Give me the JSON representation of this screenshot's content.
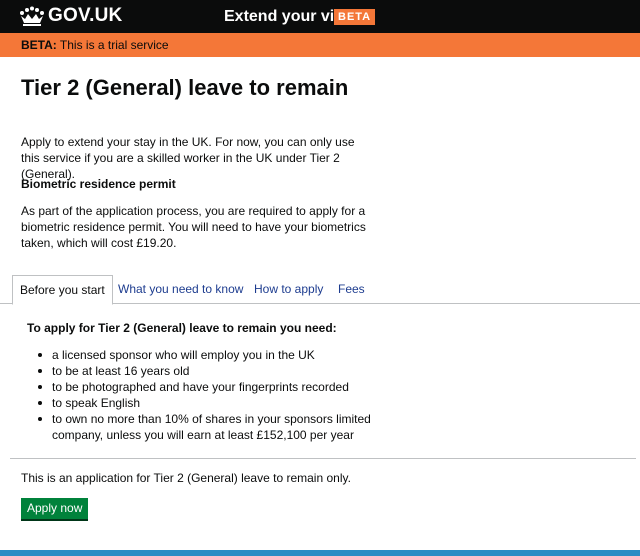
{
  "header": {
    "logo_text": "GOV.UK",
    "service_name": "Extend your visa",
    "phase_tag": "BETA"
  },
  "phase_banner": {
    "tag": "BETA:",
    "text": " This is a trial service"
  },
  "main": {
    "title": "Tier 2 (General) leave to remain",
    "intro": "Apply to extend your stay in the UK. For now, you can only use this service if you are a skilled worker in the UK under Tier 2 (General).",
    "brp_heading": "Biometric residence permit",
    "brp_text": "As part of the application process, you are required to apply for a biometric residence permit. You will need to have your biometrics taken, which will cost £19.20."
  },
  "tabs": [
    {
      "label": "Before you start",
      "active": true
    },
    {
      "label": "What you need to know",
      "active": false
    },
    {
      "label": "How to apply",
      "active": false
    },
    {
      "label": "Fees",
      "active": false
    }
  ],
  "tab_content": {
    "heading": "To apply for Tier 2 (General) leave to remain you need:",
    "requirements": [
      "a licensed sponsor who will employ you in the UK",
      "to be at least 16 years old",
      "to be photographed and have your fingerprints recorded",
      "to speak English",
      "to own no more than 10% of shares in your sponsors limited company, unless you will earn at least £152,100 per year"
    ]
  },
  "apply": {
    "note": "This is an application for Tier 2 (General) leave to remain only.",
    "button_label": "Apply now"
  },
  "colors": {
    "header_bg": "#0b0c0c",
    "beta_orange": "#f47738",
    "link_blue": "#1d3c8f",
    "button_green": "#00823b",
    "footer_blue": "#2b8cc4"
  }
}
